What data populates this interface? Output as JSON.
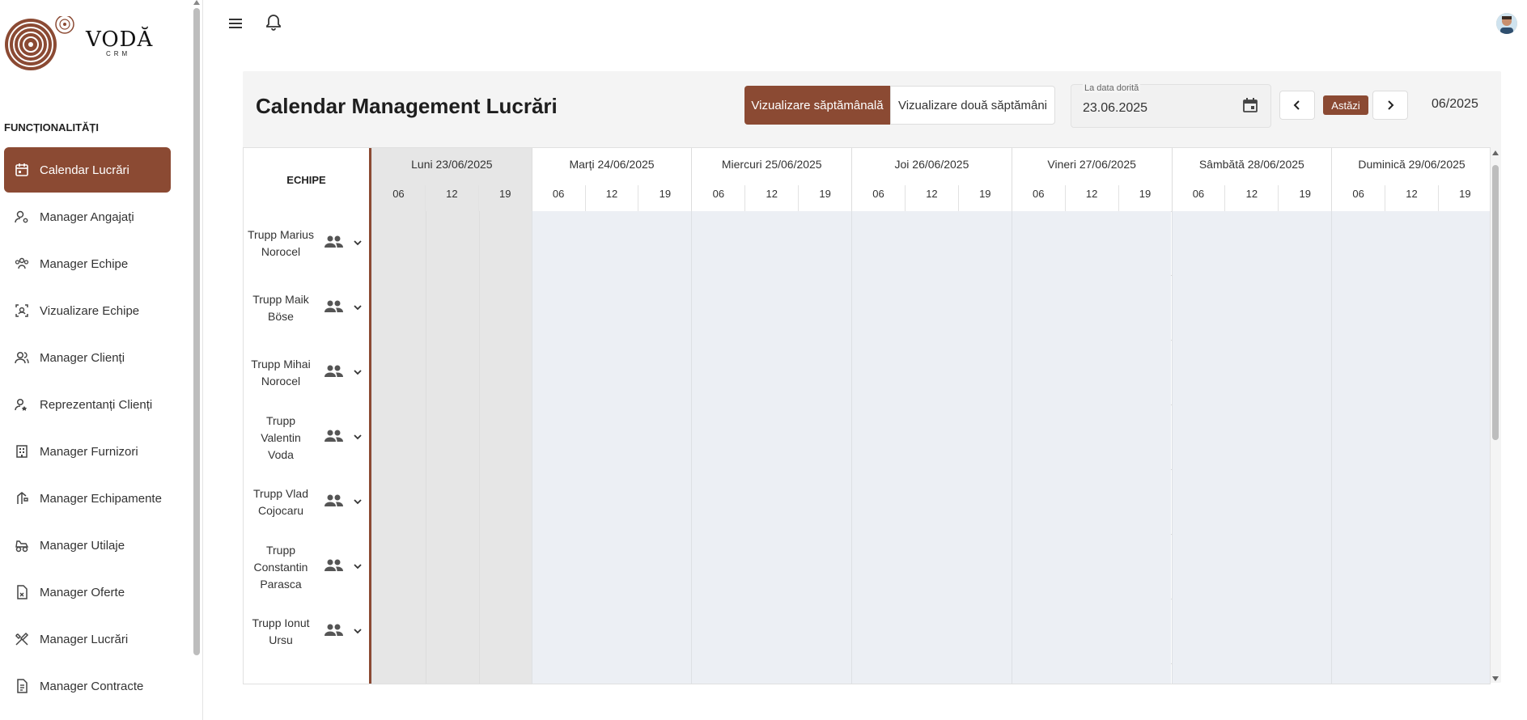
{
  "brand": {
    "name": "VODĂ",
    "sub": "CRM"
  },
  "sidebar": {
    "section_title": "FUNCȚIONALITĂȚI",
    "items": [
      {
        "label": "Calendar Lucrări",
        "icon": "calendar-icon",
        "active": true
      },
      {
        "label": "Manager Angajați",
        "icon": "user-gear-icon"
      },
      {
        "label": "Manager Echipe",
        "icon": "team-icon"
      },
      {
        "label": "Vizualizare Echipe",
        "icon": "view-team-icon"
      },
      {
        "label": "Manager Clienți",
        "icon": "clients-icon"
      },
      {
        "label": "Reprezentanți Clienți",
        "icon": "representative-icon"
      },
      {
        "label": "Manager Furnizori",
        "icon": "building-icon"
      },
      {
        "label": "Manager Echipamente",
        "icon": "equipment-icon"
      },
      {
        "label": "Manager Utilaje",
        "icon": "machinery-icon"
      },
      {
        "label": "Manager Oferte",
        "icon": "offer-document-icon"
      },
      {
        "label": "Manager Lucrări",
        "icon": "tools-icon"
      },
      {
        "label": "Manager Contracte",
        "icon": "contract-document-icon"
      }
    ]
  },
  "header": {
    "title": "Calendar Management Lucrări",
    "view_week": "Vizualizare săptămânală",
    "view_two_weeks": "Vizualizare două săptămâni",
    "date_label": "La data dorită",
    "date_value": "23.06.2025",
    "today_label": "Astăzi",
    "month_label": "06/2025"
  },
  "calendar": {
    "teams_header": "ECHIPE",
    "days": [
      {
        "label": "Luni 23/06/2025",
        "today": true
      },
      {
        "label": "Marți 24/06/2025"
      },
      {
        "label": "Miercuri 25/06/2025"
      },
      {
        "label": "Joi 26/06/2025"
      },
      {
        "label": "Vineri 27/06/2025"
      },
      {
        "label": "Sâmbătă 28/06/2025"
      },
      {
        "label": "Duminică 29/06/2025"
      }
    ],
    "hours": [
      "06",
      "12",
      "19"
    ],
    "teams": [
      {
        "name": "Trupp Marius Norocel"
      },
      {
        "name": "Trupp Maik Böse"
      },
      {
        "name": "Trupp Mihai Norocel"
      },
      {
        "name": "Trupp Valentin Voda"
      },
      {
        "name": "Trupp Vlad Cojocaru"
      },
      {
        "name": "Trupp Constantin Parasca"
      },
      {
        "name": "Trupp Ionut Ursu"
      }
    ]
  },
  "colors": {
    "accent": "#8b4a33",
    "cell": "#eceff4",
    "today": "#e6e6e6"
  }
}
